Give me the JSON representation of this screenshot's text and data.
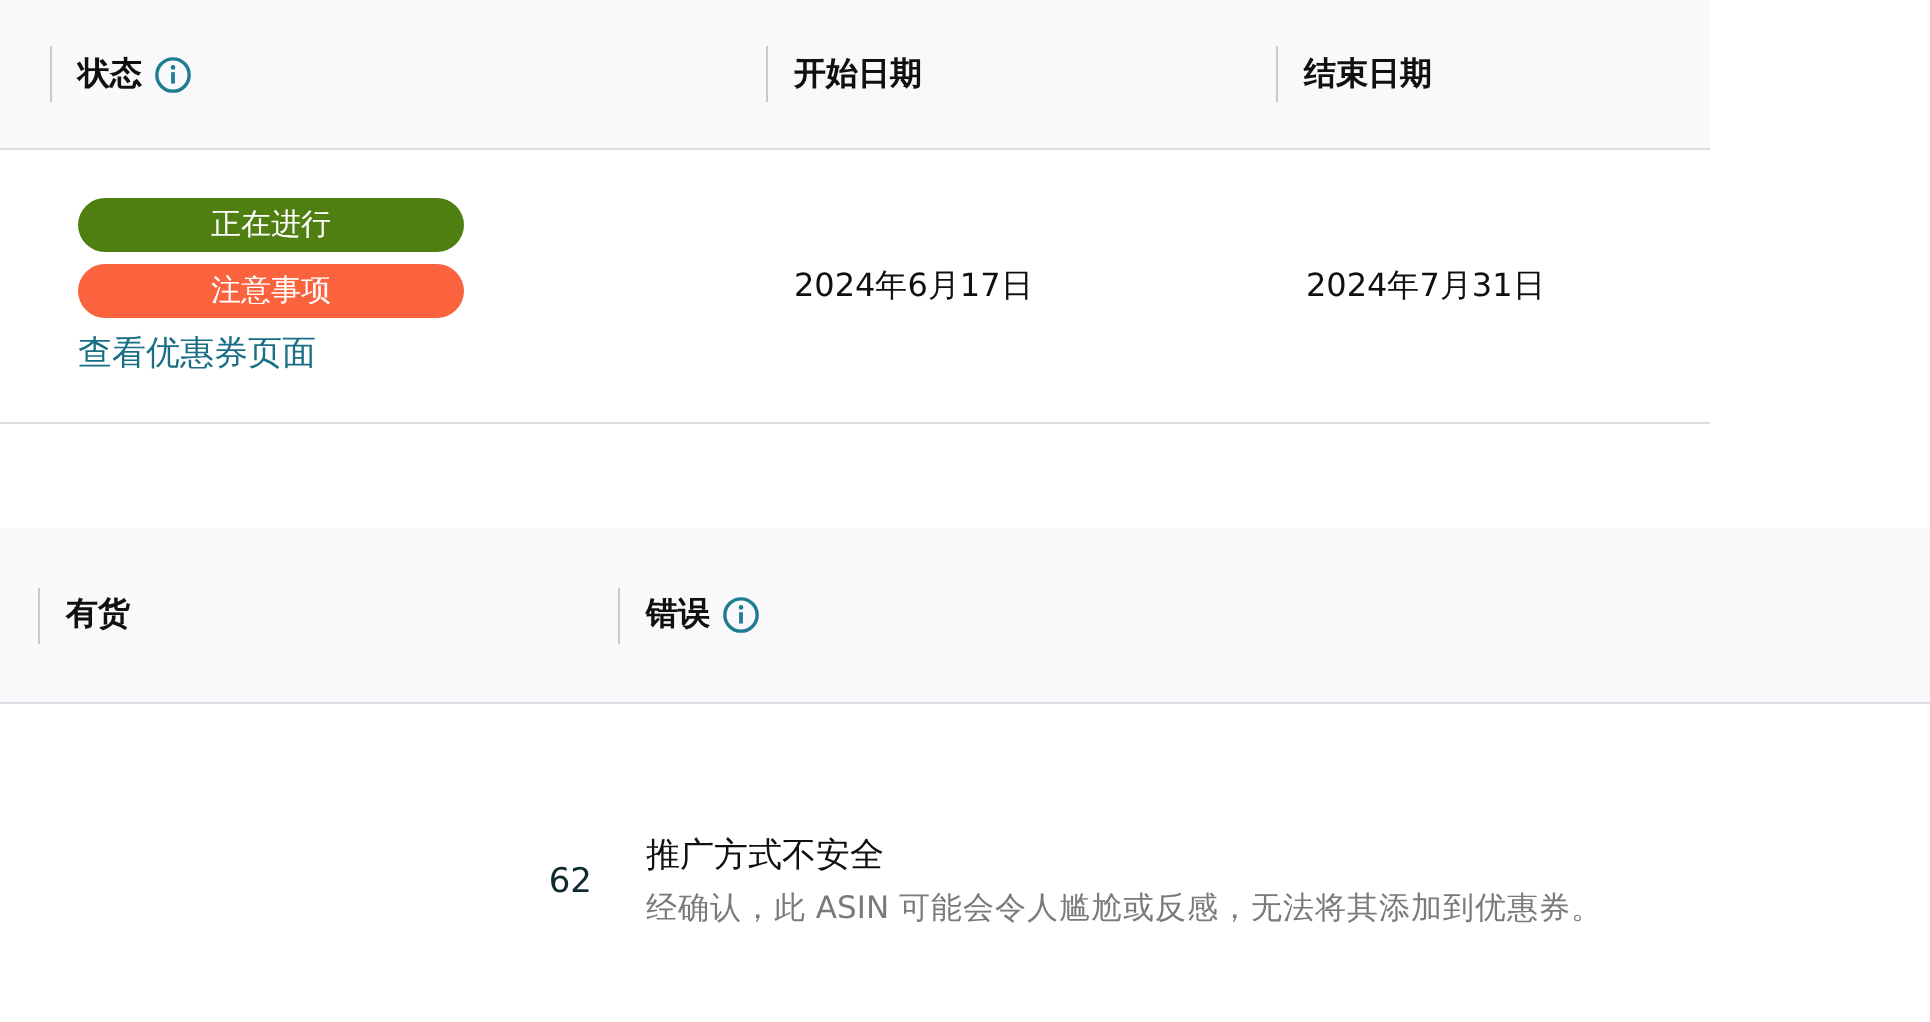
{
  "coupon_table": {
    "columns": [
      {
        "label": "状态",
        "info": true
      },
      {
        "label": "开始日期",
        "info": false
      },
      {
        "label": "结束日期",
        "info": false
      }
    ],
    "row": {
      "badges": [
        {
          "label": "正在进行",
          "kind": "active"
        },
        {
          "label": "注意事项",
          "kind": "warning"
        }
      ],
      "link": "查看优惠券页面",
      "start_date": "2024年6月17日",
      "end_date": "2024年7月31日"
    }
  },
  "asin_table": {
    "columns": [
      {
        "label": "有货",
        "info": false
      },
      {
        "label": "错误",
        "info": true
      }
    ],
    "row": {
      "stock": "62",
      "error_title": "推广方式不安全",
      "error_description": "经确认，此 ASIN 可能会令人尴尬或反感，无法将其添加到优惠券。"
    }
  }
}
